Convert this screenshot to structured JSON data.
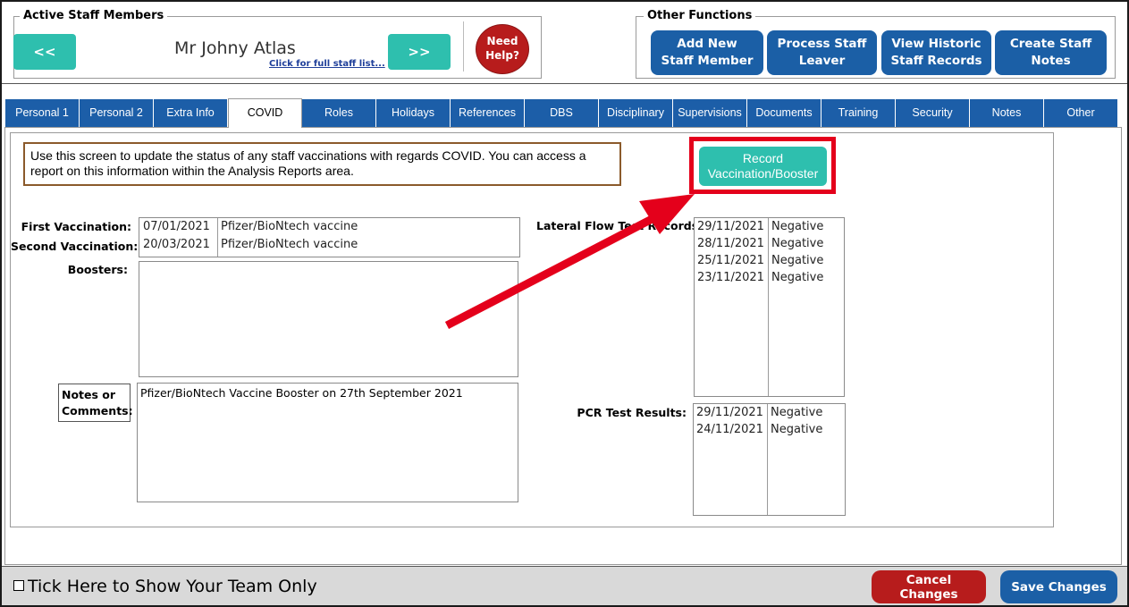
{
  "staff": {
    "group_title": "Active Staff Members",
    "prev_label": "<<",
    "next_label": ">>",
    "name": "Mr Johny Atlas",
    "full_list_link": "Click for full staff list...",
    "help_line1": "Need",
    "help_line2": "Help?"
  },
  "functions": {
    "group_title": "Other Functions",
    "buttons": [
      {
        "line1": "Add New",
        "line2": "Staff Member"
      },
      {
        "line1": "Process Staff",
        "line2": "Leaver"
      },
      {
        "line1": "View Historic",
        "line2": "Staff Records"
      },
      {
        "line1": "Create Staff",
        "line2": "Notes"
      }
    ]
  },
  "tabs": [
    {
      "label": "Personal 1"
    },
    {
      "label": "Personal 2"
    },
    {
      "label": "Extra Info"
    },
    {
      "label": "COVID"
    },
    {
      "label": "Roles"
    },
    {
      "label": "Holidays"
    },
    {
      "label": "References"
    },
    {
      "label": "DBS"
    },
    {
      "label": "Disciplinary"
    },
    {
      "label": "Supervisions"
    },
    {
      "label": "Documents"
    },
    {
      "label": "Training"
    },
    {
      "label": "Security"
    },
    {
      "label": "Notes"
    },
    {
      "label": "Other"
    }
  ],
  "active_tab": "COVID",
  "covid": {
    "info_text": "Use this screen to update the status of any staff vaccinations with regards COVID.  You can access a report on this information within the Analysis Reports area.",
    "record_line1": "Record",
    "record_line2": "Vaccination/Booster",
    "first_vaccination_label": "First Vaccination:",
    "second_vaccination_label": "Second Vaccination:",
    "vaccinations": [
      {
        "date": "07/01/2021",
        "vaccine": "Pfizer/BioNtech vaccine"
      },
      {
        "date": "20/03/2021",
        "vaccine": "Pfizer/BioNtech vaccine"
      }
    ],
    "boosters_label": "Boosters:",
    "notes_label_line1": "Notes or",
    "notes_label_line2": "Comments:",
    "notes_text": "Pfizer/BioNtech Vaccine Booster on 27th September 2021",
    "lateral_flow_label": "Lateral Flow Test Records:",
    "lateral_flow": [
      {
        "date": "29/11/2021",
        "result": "Negative"
      },
      {
        "date": "28/11/2021",
        "result": "Negative"
      },
      {
        "date": "25/11/2021",
        "result": "Negative"
      },
      {
        "date": "23/11/2021",
        "result": "Negative"
      }
    ],
    "pcr_label": "PCR Test Results:",
    "pcr": [
      {
        "date": "29/11/2021",
        "result": "Negative"
      },
      {
        "date": "24/11/2021",
        "result": "Negative"
      }
    ]
  },
  "footer": {
    "team_only_label": "Tick Here to Show Your Team Only",
    "cancel_label": "Cancel Changes",
    "save_label": "Save Changes"
  },
  "colors": {
    "teal": "#2ebfae",
    "blue": "#1b5fa6",
    "red": "#b71c1c",
    "highlight": "#e4001b"
  }
}
